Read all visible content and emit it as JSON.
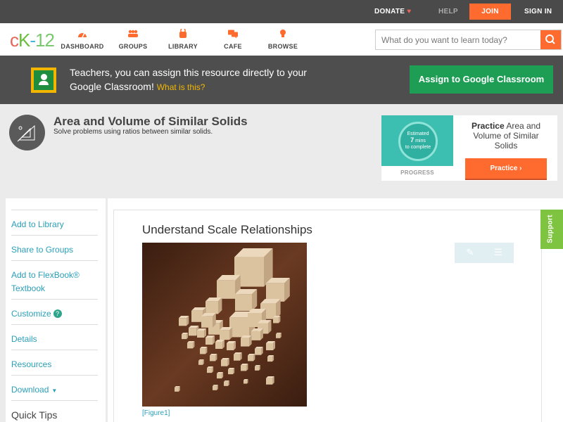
{
  "topbar": {
    "donate_label": "DONATE",
    "heart_icon": "heart-icon",
    "help_label": "HELP",
    "join_label": "JOIN",
    "signin_label": "SIGN IN"
  },
  "navbar": {
    "logo": {
      "c": "c",
      "k": "K",
      "dash": "-",
      "num": "12"
    },
    "items": [
      {
        "label": "DASHBOARD",
        "icon": "dashboard-gauge-icon"
      },
      {
        "label": "GROUPS",
        "icon": "groups-people-icon"
      },
      {
        "label": "LIBRARY",
        "icon": "library-bag-icon"
      },
      {
        "label": "CAFE",
        "icon": "cafe-chat-icon"
      },
      {
        "label": "BROWSE",
        "icon": "browse-bulb-icon"
      }
    ],
    "search_placeholder": "What do you want to learn today?"
  },
  "classroom_banner": {
    "text": "Teachers, you can assign this resource directly to your Google Classroom!",
    "what_is_this": "What is this?",
    "button_label": "Assign to Google Classroom"
  },
  "concept": {
    "title": "Area and Volume of Similar Solids",
    "subtitle": "Solve problems using ratios between similar solids."
  },
  "practice_card": {
    "estimated_label": "Estimated",
    "minutes": "7",
    "mins_label": "mins",
    "to_complete_label": "to complete",
    "progress_label": "PROGRESS",
    "title_bold": "Practice",
    "title_rest": "Area and Volume of Similar Solids",
    "button_label": "Practice"
  },
  "sidebar": {
    "items": [
      {
        "label": "Add to Library"
      },
      {
        "label": "Share to Groups"
      },
      {
        "label": "Add to FlexBook® Textbook"
      },
      {
        "label": "Customize"
      },
      {
        "label": "Details"
      },
      {
        "label": "Resources"
      },
      {
        "label": "Download"
      }
    ],
    "quick_tips": "Quick Tips"
  },
  "content": {
    "title": "Understand Scale Relationships",
    "figure_caption": "[Figure1]"
  },
  "support_tab": "Support",
  "colors": {
    "accent_orange": "#ff6a2f",
    "link_blue": "#2a9fb8",
    "classroom_green": "#1e9e55",
    "support_green": "#7ec440"
  }
}
